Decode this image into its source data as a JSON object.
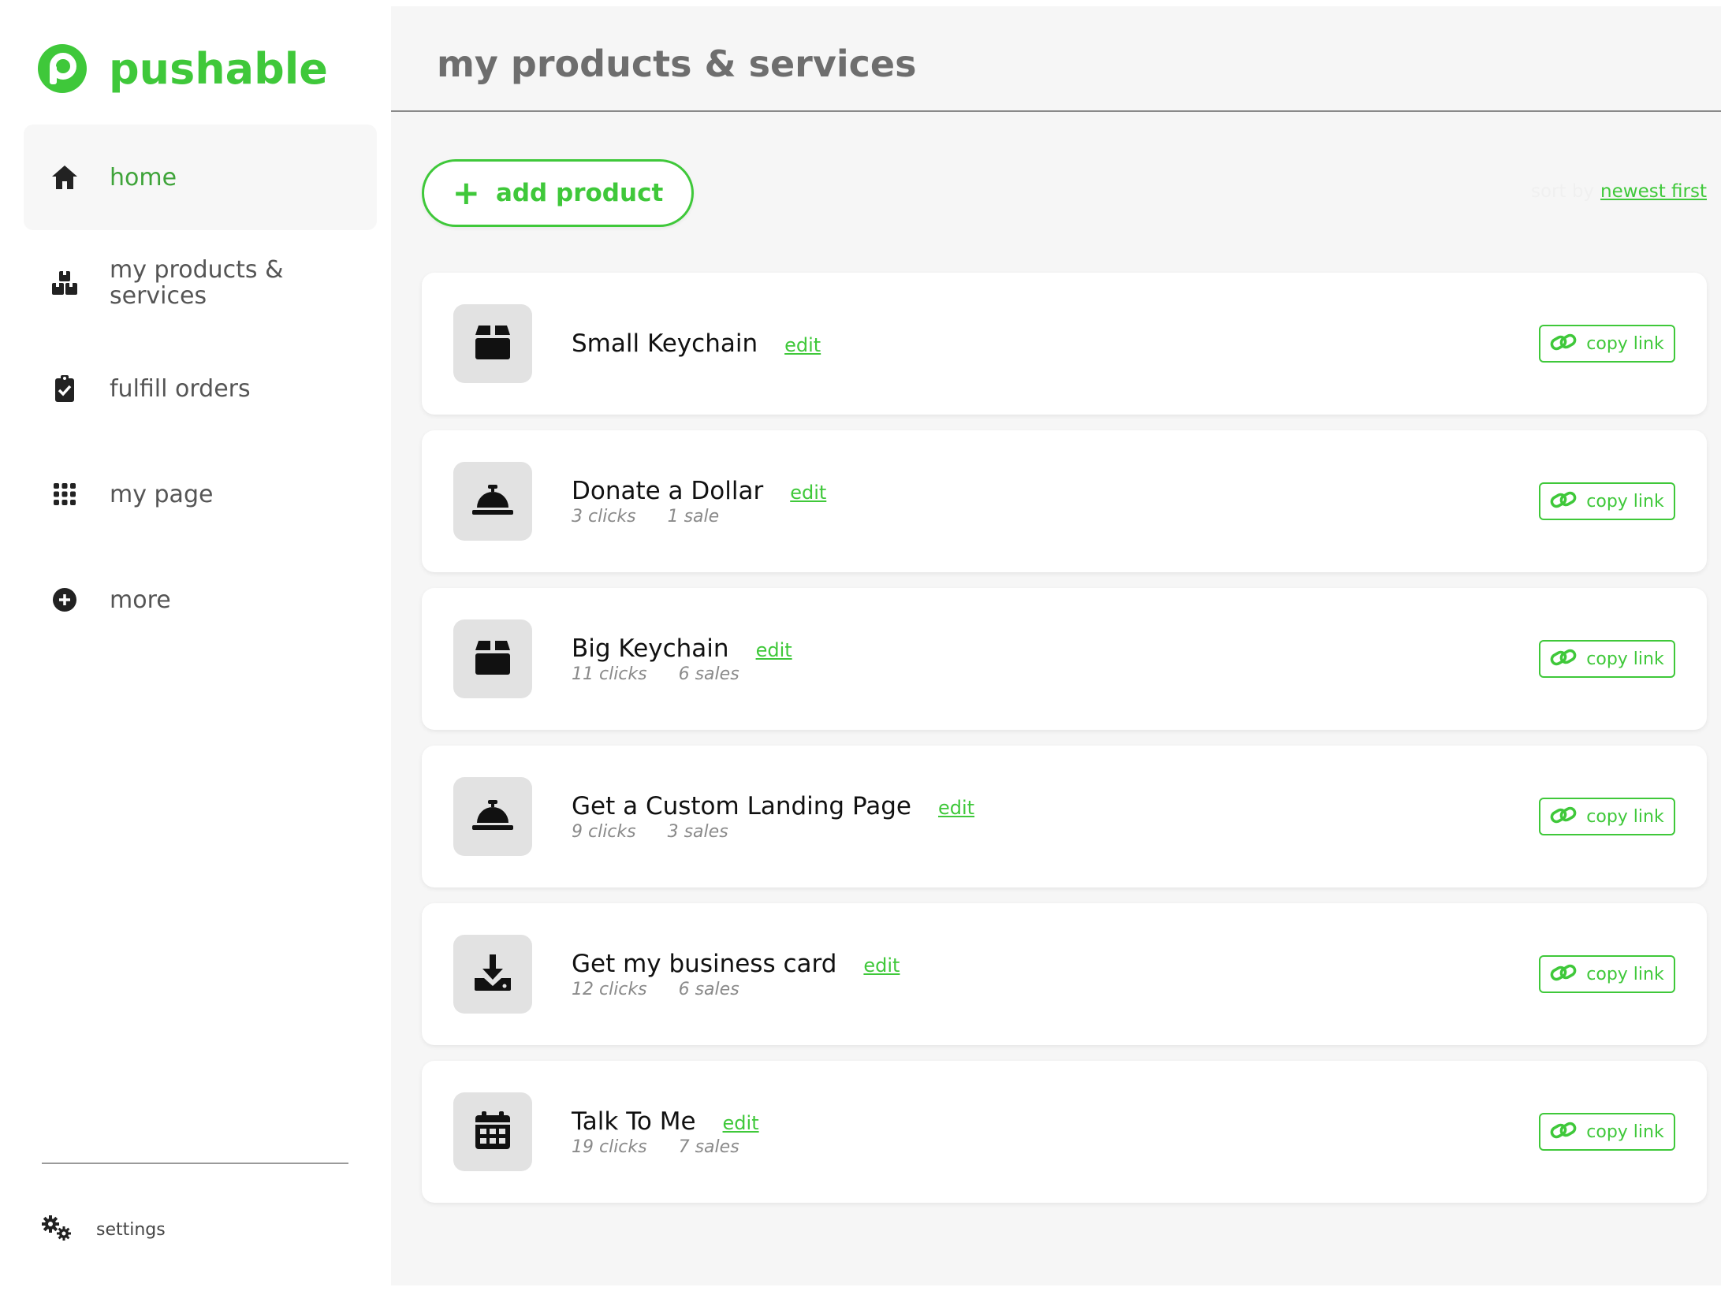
{
  "brand": {
    "name": "pushable",
    "color": "#3fc83a"
  },
  "sidebar": {
    "items": [
      {
        "label": "home",
        "icon": "home-icon",
        "active": true
      },
      {
        "label": "my products & services",
        "icon": "boxes-icon",
        "active": false
      },
      {
        "label": "fulfill orders",
        "icon": "clipboard-check-icon",
        "active": false
      },
      {
        "label": "my page",
        "icon": "grid-icon",
        "active": false
      },
      {
        "label": "more",
        "icon": "plus-circle-icon",
        "active": false
      }
    ],
    "settings_label": "settings"
  },
  "header": {
    "title": "my products & services"
  },
  "toolbar": {
    "add_label": "add product",
    "sort_label": "sort by",
    "sort_value": "newest first"
  },
  "products": [
    {
      "name": "Small Keychain",
      "edit_label": "edit",
      "clicks": "",
      "sales": "",
      "icon": "box-icon",
      "copy_label": "copy link"
    },
    {
      "name": "Donate a Dollar",
      "edit_label": "edit",
      "clicks": "3 clicks",
      "sales": "1 sale",
      "icon": "service-bell-icon",
      "copy_label": "copy link"
    },
    {
      "name": "Big Keychain",
      "edit_label": "edit",
      "clicks": "11 clicks",
      "sales": "6 sales",
      "icon": "box-icon",
      "copy_label": "copy link"
    },
    {
      "name": "Get a Custom Landing Page",
      "edit_label": "edit",
      "clicks": "9 clicks",
      "sales": "3 sales",
      "icon": "service-bell-icon",
      "copy_label": "copy link"
    },
    {
      "name": "Get my business card",
      "edit_label": "edit",
      "clicks": "12 clicks",
      "sales": "6 sales",
      "icon": "download-icon",
      "copy_label": "copy link"
    },
    {
      "name": "Talk To Me",
      "edit_label": "edit",
      "clicks": "19 clicks",
      "sales": "7 sales",
      "icon": "calendar-icon",
      "copy_label": "copy link"
    }
  ]
}
